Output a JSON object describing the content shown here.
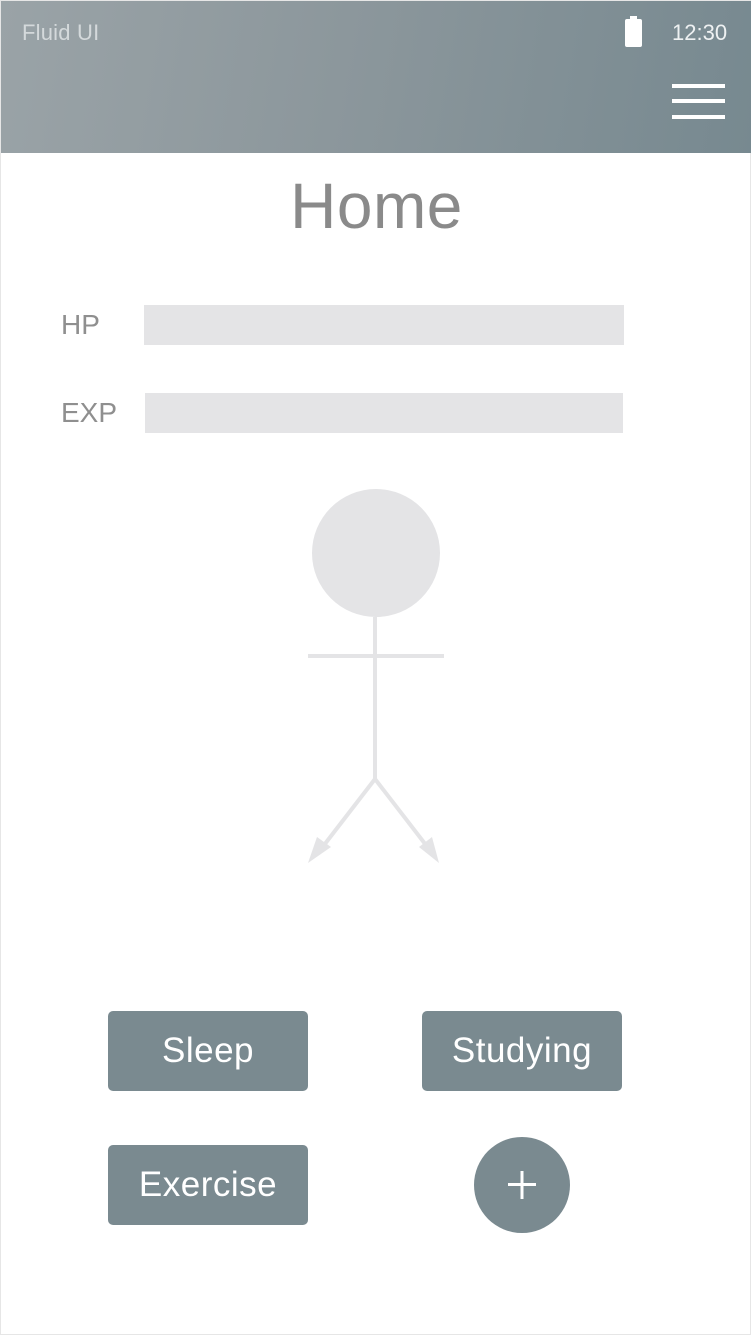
{
  "status_bar": {
    "app_name": "Fluid UI",
    "time": "12:30",
    "battery_icon": "battery-icon"
  },
  "header": {
    "menu_icon": "hamburger-menu-icon"
  },
  "page": {
    "title": "Home"
  },
  "stats": {
    "hp_label": "HP",
    "exp_label": "EXP"
  },
  "avatar": {
    "icon": "stick-figure-icon"
  },
  "actions": {
    "sleep_label": "Sleep",
    "studying_label": "Studying",
    "exercise_label": "Exercise",
    "add_icon": "plus-icon"
  },
  "colors": {
    "header_start": "#9aa3a7",
    "header_end": "#778990",
    "button": "#7a8a90",
    "bar": "#e4e4e6",
    "figure": "#e4e4e6",
    "text_gray": "#8a8a8a"
  }
}
